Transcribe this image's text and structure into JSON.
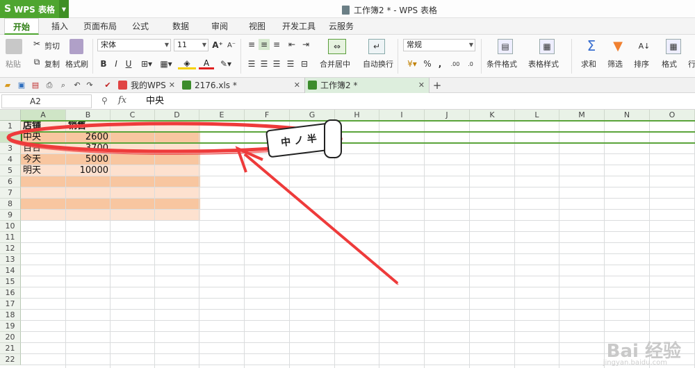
{
  "app": {
    "menu_label": "WPS 表格",
    "window_title": "工作簿2 * - WPS 表格"
  },
  "ribbon_tabs": [
    "开始",
    "插入",
    "页面布局",
    "公式",
    "数据",
    "审阅",
    "视图",
    "开发工具",
    "云服务"
  ],
  "ribbon": {
    "clipboard": {
      "paste": "粘贴",
      "cut": "剪切",
      "copy": "复制",
      "format_painter": "格式刷"
    },
    "font": {
      "name": "宋体",
      "size": "11"
    },
    "alignment": {
      "merge_center": "合并居中",
      "wrap_text": "自动换行"
    },
    "number": {
      "format": "常规"
    },
    "styles": {
      "conditional_format": "条件格式",
      "table_style": "表格样式"
    },
    "editing": {
      "sum": "求和",
      "filter": "筛选",
      "sort": "排序",
      "format": "格式",
      "row_col": "行"
    }
  },
  "doc_tabs": [
    {
      "label": "我的WPS",
      "color": "#e04444"
    },
    {
      "label": "2176.xls *",
      "color": "#3c8c2c"
    },
    {
      "label": "工作簿2 *",
      "color": "#3c8c2c"
    }
  ],
  "formula_bar": {
    "name_box": "A2",
    "fx": "fx",
    "value": "中央"
  },
  "grid": {
    "columns": [
      "A",
      "B",
      "C",
      "D",
      "E",
      "F",
      "G",
      "H",
      "I",
      "J",
      "K",
      "L",
      "M",
      "N",
      "O"
    ],
    "rows": [
      "1",
      "2",
      "3",
      "4",
      "5",
      "6",
      "7",
      "8",
      "9",
      "10",
      "11",
      "12",
      "13",
      "14",
      "15",
      "16",
      "17",
      "18",
      "19",
      "20",
      "21",
      "22"
    ],
    "header_row": [
      "店铺",
      "销售"
    ],
    "data": [
      {
        "store": "中央",
        "sales": "2600"
      },
      {
        "store": "百合",
        "sales": "3700"
      },
      {
        "store": "今天",
        "sales": "5000"
      },
      {
        "store": "明天",
        "sales": "10000"
      }
    ]
  },
  "annotation": {
    "sticker_text": "中 ノ 半"
  },
  "watermark": {
    "brand": "Bai 经验",
    "url": "jingyan.baidu.com"
  },
  "colors": {
    "accent": "#4ea52f",
    "band_dark": "#f8c6a0",
    "band_light": "#fde1cf",
    "red_mark": "#ee3b3b"
  }
}
